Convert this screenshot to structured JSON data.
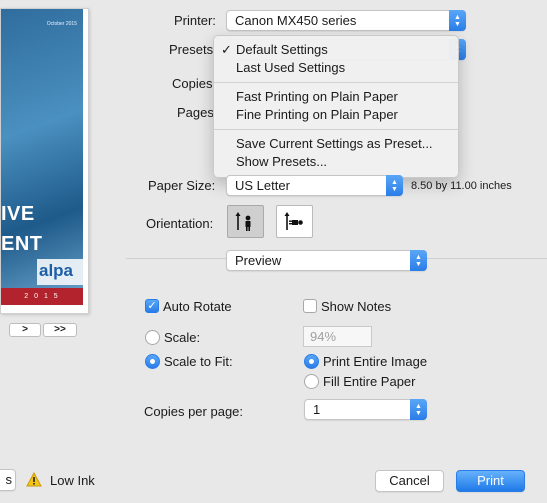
{
  "thumbnail": {
    "date": "October 2015",
    "line1": "IVE",
    "line2": "ENT",
    "brand": "alpa",
    "year": "2 0 1 5"
  },
  "page_nav": {
    "next_label": ">",
    "last_label": ">>"
  },
  "printer": {
    "label": "Printer:",
    "value": "Canon MX450 series"
  },
  "presets": {
    "label": "Presets",
    "menu": {
      "group1": [
        "Default Settings",
        "Last Used Settings"
      ],
      "group2": [
        "Fast Printing on Plain Paper",
        "Fine Printing on Plain Paper"
      ],
      "group3": [
        "Save Current Settings as Preset...",
        "Show Presets..."
      ],
      "checked": "Default Settings"
    }
  },
  "copies": {
    "label": "Copies"
  },
  "pages": {
    "label": "Pages"
  },
  "paper_size": {
    "label": "Paper Size:",
    "value": "US Letter",
    "dimensions": "8.50 by 11.00 inches"
  },
  "orientation": {
    "label": "Orientation:"
  },
  "section": {
    "value": "Preview"
  },
  "options": {
    "auto_rotate": "Auto Rotate",
    "show_notes": "Show Notes",
    "scale": "Scale:",
    "scale_value": "94%",
    "scale_to_fit": "Scale to Fit:",
    "print_entire_image": "Print Entire Image",
    "fill_entire_paper": "Fill Entire Paper",
    "copies_per_page_label": "Copies per page:",
    "copies_per_page_value": "1"
  },
  "footer": {
    "left_cut": "s",
    "low_ink": "Low Ink",
    "cancel": "Cancel",
    "print": "Print"
  },
  "colors": {
    "accent": "#2a7de8",
    "thumbnail_band": "#b3232d"
  }
}
